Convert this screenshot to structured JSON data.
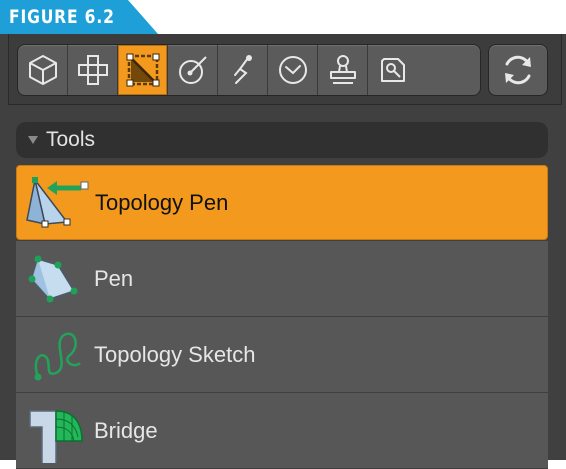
{
  "figure": {
    "label": "FIGURE 6.2"
  },
  "colors": {
    "accent": "#f39a1e",
    "figure_tab": "#1e9fd8",
    "panel": "#404040",
    "row": "#575757"
  },
  "toolbar": {
    "buttons": [
      {
        "icon": "cube-icon",
        "active": false
      },
      {
        "icon": "grid-cross-icon",
        "active": false
      },
      {
        "icon": "topology-icon",
        "active": true
      },
      {
        "icon": "brush-icon",
        "active": false
      },
      {
        "icon": "bone-icon",
        "active": false
      },
      {
        "icon": "clock-icon",
        "active": false
      },
      {
        "icon": "stamp-icon",
        "active": false
      },
      {
        "icon": "wrench-icon",
        "active": false
      }
    ],
    "refresh_icon": "refresh-icon"
  },
  "tools": {
    "header": "Tools",
    "items": [
      {
        "label": "Topology Pen",
        "icon": "topology-pen-icon",
        "selected": true
      },
      {
        "label": "Pen",
        "icon": "pen-icon",
        "selected": false
      },
      {
        "label": "Topology Sketch",
        "icon": "topology-sketch-icon",
        "selected": false
      },
      {
        "label": "Bridge",
        "icon": "bridge-icon",
        "selected": false
      }
    ]
  }
}
